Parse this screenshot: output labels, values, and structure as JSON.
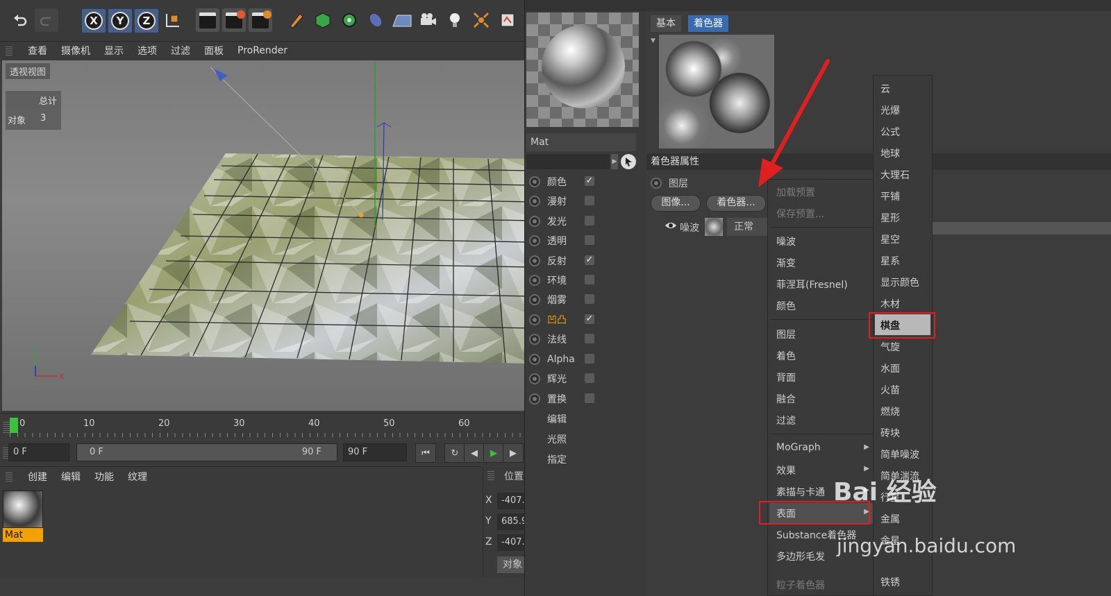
{
  "toolbar": {
    "axis_x": "X",
    "axis_y": "Y",
    "axis_z": "Z"
  },
  "viewport_menu": [
    "查看",
    "摄像机",
    "显示",
    "选项",
    "过滤",
    "面板",
    "ProRender"
  ],
  "viewport": {
    "label": "透视视图",
    "hud_header": "总计",
    "hud_label": "对象",
    "hud_value": "3"
  },
  "timeline": {
    "ticks": [
      "0",
      "10",
      "20",
      "30",
      "40",
      "50",
      "60"
    ],
    "start_field": "0 F",
    "range_start": "0 F",
    "range_end": "90 F",
    "end_field": "90 F"
  },
  "material_manager": {
    "menu": [
      "创建",
      "编辑",
      "功能",
      "纹理"
    ],
    "material_name": "Mat"
  },
  "coords": {
    "header": "位置",
    "rows": [
      {
        "axis": "X",
        "value": "-407."
      },
      {
        "axis": "Y",
        "value": "685.9"
      },
      {
        "axis": "Z",
        "value": "-407."
      }
    ],
    "button": "对象"
  },
  "material_editor": {
    "name": "Mat",
    "channels": [
      {
        "label": "颜色",
        "checked": "✓"
      },
      {
        "label": "漫射",
        "checked": ""
      },
      {
        "label": "发光",
        "checked": ""
      },
      {
        "label": "透明",
        "checked": ""
      },
      {
        "label": "反射",
        "checked": "✓"
      },
      {
        "label": "环境",
        "checked": ""
      },
      {
        "label": "烟雾",
        "checked": ""
      },
      {
        "label": "凹凸",
        "checked": "✓"
      },
      {
        "label": "法线",
        "checked": ""
      },
      {
        "label": "Alpha",
        "checked": ""
      },
      {
        "label": "辉光",
        "checked": ""
      },
      {
        "label": "置换",
        "checked": ""
      }
    ],
    "sub_items": [
      "编辑",
      "光照",
      "指定"
    ]
  },
  "shader_panel": {
    "tabs": [
      "基本",
      "着色器"
    ],
    "section": "着色器属性",
    "layer_label": "图层",
    "btn_image": "图像...",
    "btn_shader": "着色器...",
    "layer_name": "噪波",
    "blend": "正常"
  },
  "context_menu": {
    "items": [
      {
        "label": "加载预置",
        "disabled": true
      },
      {
        "label": "保存预置...",
        "disabled": true
      },
      {
        "label": "噪波"
      },
      {
        "label": "渐变"
      },
      {
        "label": "菲涅耳(Fresnel)"
      },
      {
        "label": "颜色"
      },
      {
        "label": "图层"
      },
      {
        "label": "着色"
      },
      {
        "label": "背面"
      },
      {
        "label": "融合"
      },
      {
        "label": "过滤"
      },
      {
        "label": "MoGraph"
      },
      {
        "label": "效果"
      },
      {
        "label": "素描与卡通"
      },
      {
        "label": "表面"
      },
      {
        "label": "Substance着色器"
      },
      {
        "label": "多边形毛发"
      },
      {
        "label": "粒子着色器"
      }
    ]
  },
  "surface_submenu": [
    "云",
    "光爆",
    "公式",
    "地球",
    "大理石",
    "平铺",
    "星形",
    "星空",
    "星系",
    "显示颜色",
    "木材",
    "棋盘",
    "气旋",
    "水面",
    "火苗",
    "燃烧",
    "砖块",
    "简单噪波",
    "简单湍流",
    "行星",
    "金属",
    "金星",
    "铁锈"
  ],
  "watermark": {
    "brand": "Bai 经验",
    "url": "jingyan.baidu.com"
  },
  "colors": {
    "accent_orange": "#f2a100",
    "highlight_red": "#e02020",
    "panel": "#3a3a3a"
  }
}
